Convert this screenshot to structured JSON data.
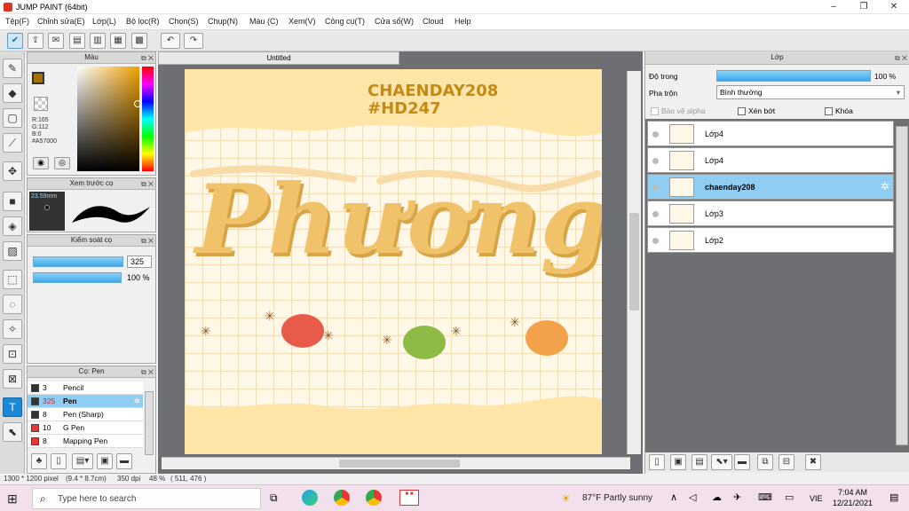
{
  "window": {
    "title": "JUMP PAINT (64bit)",
    "minimize": "–",
    "maximize": "❐",
    "close": "✕"
  },
  "menu": [
    "Tệp(F)",
    "Chỉnh sửa(E)",
    "Lớp(L)",
    "Bộ lọc(R)",
    "Chọn(S)",
    "Chụp(N)",
    "Màu (C)",
    "Xem(V)",
    "Công cụ(T)",
    "Cửa sổ(W)",
    "Cloud",
    "Help"
  ],
  "color_panel": {
    "title": "Màu",
    "r": "R:165",
    "g": "G:112",
    "b": "B:0",
    "hex": "#A57000",
    "main_color": "#a57000"
  },
  "brush_preview": {
    "title": "Xem trước cọ",
    "size": "23.59mm"
  },
  "brush_control": {
    "title": "Kiểm soát cọ",
    "size_value": "325",
    "opacity_value": "100 %"
  },
  "brush_list": {
    "title": "Cọ: Pen",
    "items": [
      {
        "size": "3",
        "name": "Pencil",
        "color": "#333333"
      },
      {
        "size": "325",
        "name": "Pen",
        "color": "#333333"
      },
      {
        "size": "8",
        "name": "Pen (Sharp)",
        "color": "#333333"
      },
      {
        "size": "10",
        "name": "G Pen",
        "color": "#e53935"
      },
      {
        "size": "8",
        "name": "Mapping Pen",
        "color": "#e53935"
      }
    ]
  },
  "document": {
    "tab": "Untitled"
  },
  "artwork": {
    "handle": "CHAENDAY208",
    "tag": "#HD247",
    "word": "Phương"
  },
  "layers_panel": {
    "title": "Lớp",
    "opacity_label": "Độ trong",
    "opacity_value": "100 %",
    "blend_label": "Pha trộn",
    "blend_value": "Bình thường",
    "protect_alpha": "Bảo vệ alpha",
    "clip": "Xén bớt",
    "lock": "Khóa",
    "layers": [
      {
        "name": "Lớp4",
        "selected": false
      },
      {
        "name": "Lớp4",
        "selected": false
      },
      {
        "name": "chaenday208",
        "selected": true
      },
      {
        "name": "Lớp3",
        "selected": false
      },
      {
        "name": "Lớp2",
        "selected": false
      }
    ]
  },
  "status": {
    "size": "1300 * 1200 pixel",
    "physical": "(9.4 * 8.7cm)",
    "dpi": "350 dpi",
    "zoom": "48 %",
    "coords": "( 511, 476 )"
  },
  "taskbar": {
    "search_placeholder": "Type here to search",
    "weather": "87°F  Partly sunny",
    "lang": "VIE",
    "time": "7:04 AM",
    "date": "12/21/2021"
  }
}
